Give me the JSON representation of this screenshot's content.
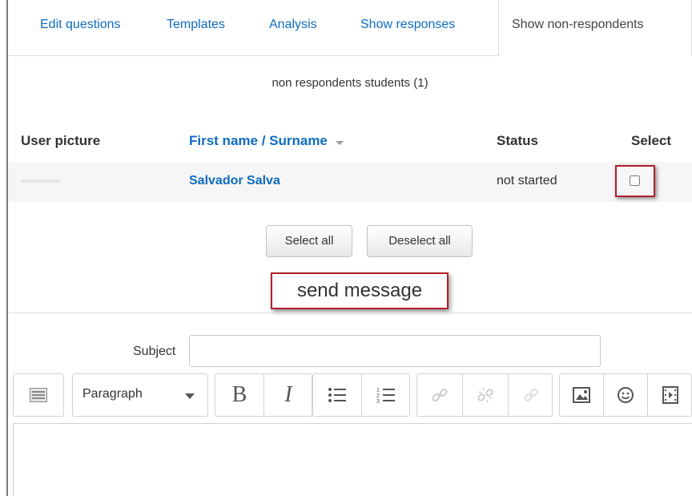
{
  "tabs": [
    {
      "label": "Edit questions"
    },
    {
      "label": "Templates"
    },
    {
      "label": "Analysis"
    },
    {
      "label": "Show responses"
    },
    {
      "label": "Show non-respondents",
      "active": true
    }
  ],
  "heading": "non respondents students (1)",
  "table": {
    "columns": [
      "User picture",
      "First name / Surname",
      "Status",
      "Select"
    ],
    "rows": [
      {
        "name": "Salvador Salva",
        "status": "not started",
        "selected": false
      }
    ]
  },
  "buttons": {
    "select_all": "Select all",
    "deselect_all": "Deselect all"
  },
  "send_message": "send message",
  "form": {
    "subject_label": "Subject",
    "subject_value": ""
  },
  "editor": {
    "format_value": "Paragraph",
    "bold_glyph": "B",
    "italic_glyph": "I",
    "icons": [
      "toolbar-toggle-icon",
      "bullet-list-icon",
      "numbered-list-icon",
      "link-icon",
      "unlink-icon",
      "anchor-icon",
      "image-icon",
      "emoticon-icon",
      "media-icon"
    ]
  },
  "colors": {
    "link": "#0f6cbf",
    "highlight_border": "#b01f2a"
  }
}
